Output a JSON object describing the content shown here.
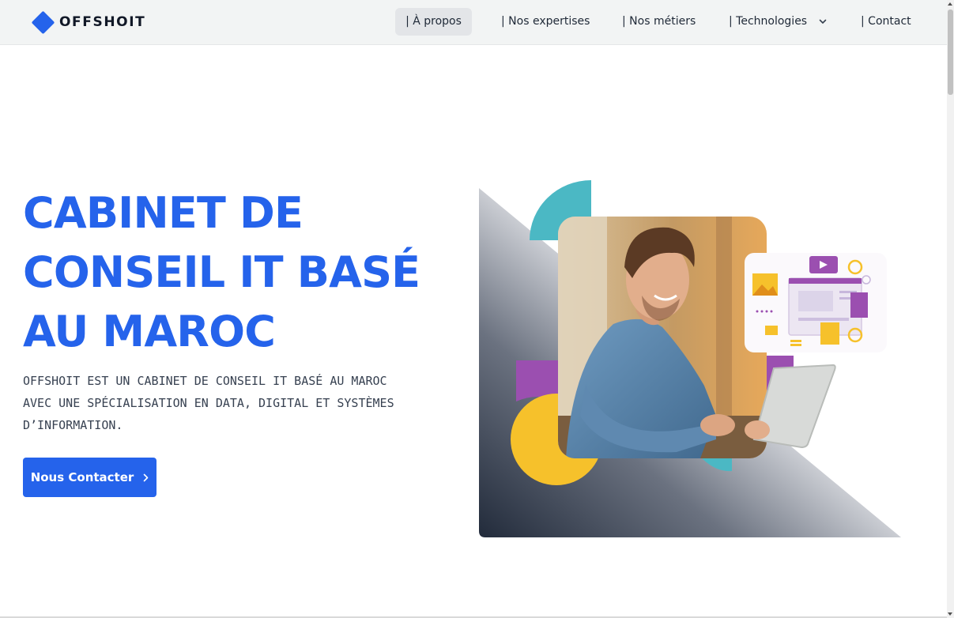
{
  "brand": {
    "name": "OFFSHOIT",
    "logo_icon": "diamond-icon",
    "accent": "#2563eb"
  },
  "nav": {
    "items": [
      {
        "label": "| À propos",
        "active": true
      },
      {
        "label": "| Nos expertises",
        "active": false
      },
      {
        "label": "| Nos métiers",
        "active": false
      },
      {
        "label": "| Technologies",
        "active": false,
        "has_dropdown": true,
        "icon": "chevron-down-icon"
      },
      {
        "label": "| Contact",
        "active": false
      }
    ]
  },
  "hero": {
    "title_lines": [
      "CABINET DE",
      "CONSEIL IT BASÉ",
      "AU MAROC"
    ],
    "description_lines": [
      "OFFSHOIT EST UN CABINET DE CONSEIL IT BASÉ AU MAROC",
      "AVEC UNE SPÉCIALISATION EN DATA, DIGITAL ET SYSTÈMES",
      "D’INFORMATION."
    ],
    "cta_label": "Nous Contacter",
    "cta_icon": "chevron-right-icon",
    "illustration": "man-with-tablet-illustration",
    "colors": {
      "teal": "#4bb8c4",
      "purple": "#9b4fb0",
      "yellow": "#f6c12b"
    }
  }
}
